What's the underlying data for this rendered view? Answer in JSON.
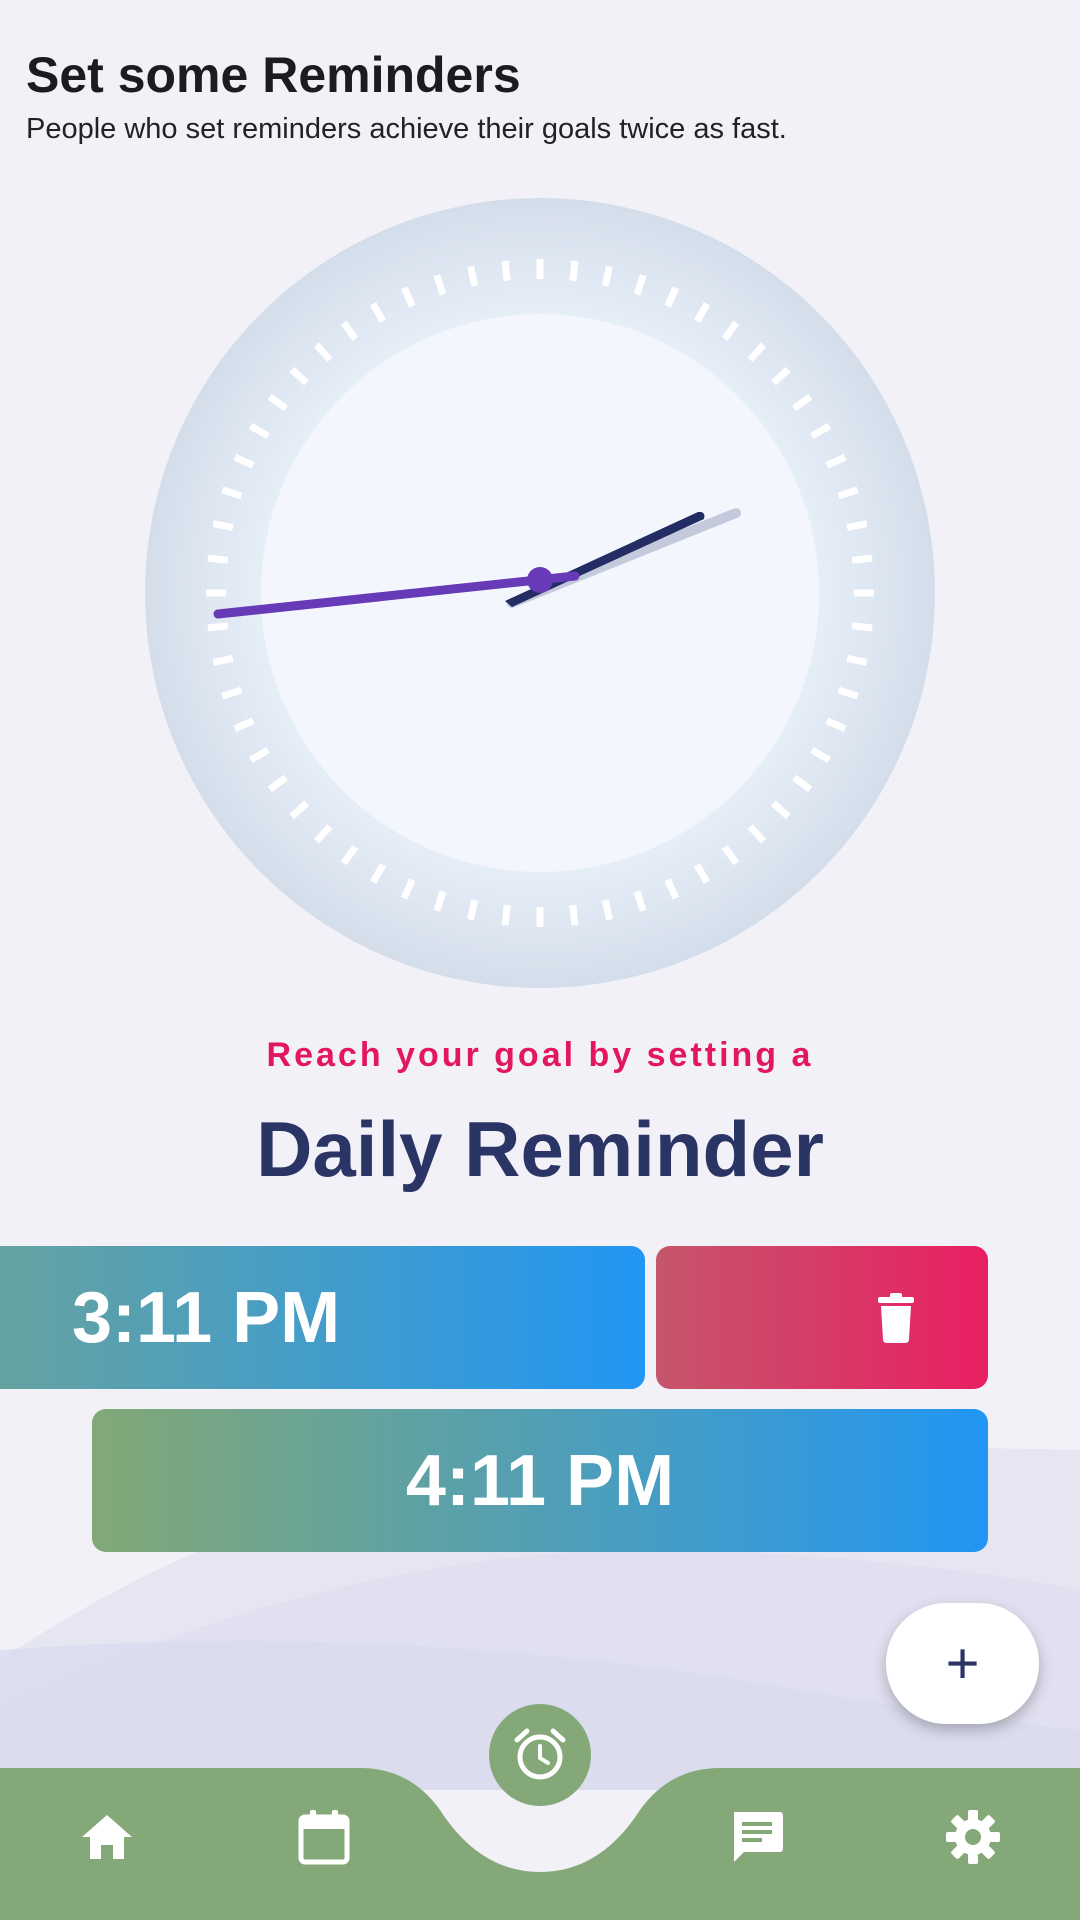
{
  "header": {
    "title": "Set some Reminders",
    "subtitle": "People who set reminders achieve their goals twice as fast."
  },
  "clock": {
    "icon": "analog-clock",
    "hour_hand_color": "#232c63",
    "minute_hand_color": "#673ab7",
    "dial_color": "#f3f7fd",
    "bezel_color": "#dde6f1"
  },
  "tagline": "Reach your goal by setting a",
  "headline": "Daily Reminder",
  "reminders": [
    {
      "time": "3:11 PM"
    },
    {
      "time": "4:11 PM"
    }
  ],
  "delete_action": {
    "icon": "trash-icon",
    "color": "#e91f63"
  },
  "fab": {
    "label": "+"
  },
  "nav": {
    "color": "#84a877",
    "items": [
      {
        "icon": "home-icon"
      },
      {
        "icon": "calendar-icon"
      },
      {
        "icon": "alarm-clock-icon",
        "active": true
      },
      {
        "icon": "chat-icon"
      },
      {
        "icon": "gear-icon"
      }
    ]
  }
}
